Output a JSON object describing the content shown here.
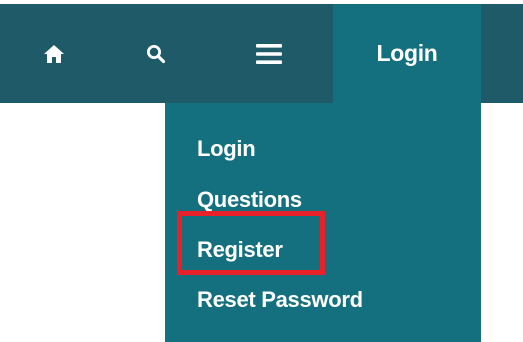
{
  "navbar": {
    "home_icon": "home-icon",
    "search_icon": "search-icon",
    "menu_icon": "hamburger-menu-icon",
    "login_label": "Login"
  },
  "dropdown": {
    "items": [
      {
        "label": "Login"
      },
      {
        "label": "Questions"
      },
      {
        "label": "Register"
      },
      {
        "label": "Reset Password"
      }
    ]
  },
  "colors": {
    "navbar_bg": "#1e5a68",
    "active_bg": "#14707e",
    "text": "#ffffff",
    "highlight": "#e8202a"
  }
}
